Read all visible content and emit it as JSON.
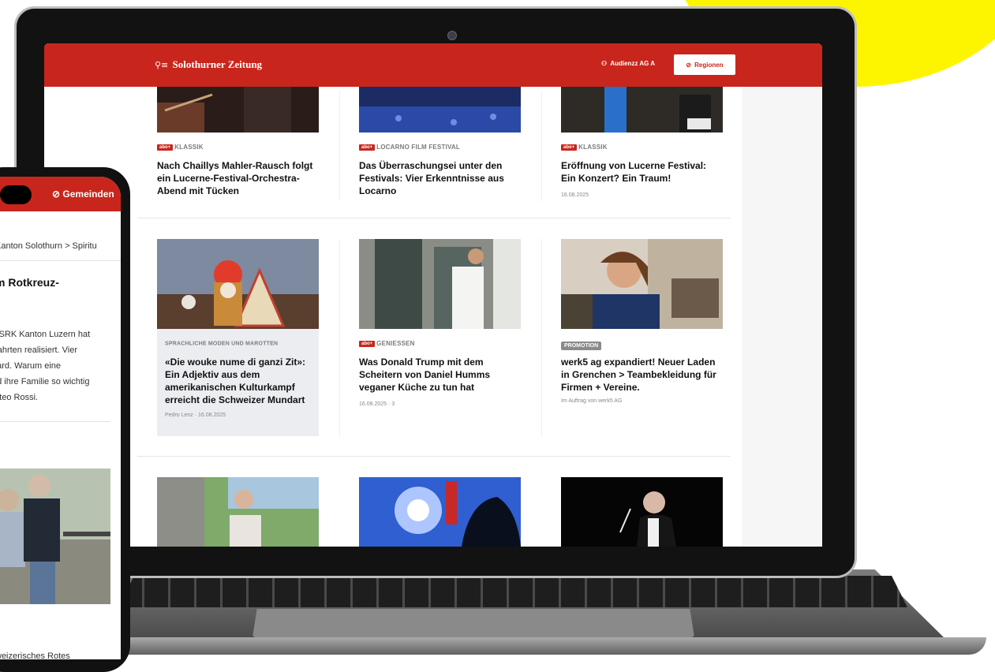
{
  "site": {
    "logo": "Solothurner Zeitung",
    "user": "Audienzz AG A",
    "regions_button": "Regionen",
    "brand_red": "#c8261c"
  },
  "rows": [
    [
      {
        "badge": "abo+",
        "kicker": "KLASSIK",
        "title": "Nach Chaillys Mahler-Rausch folgt ein Lucerne-Festival-Orchestra-Abend mit Tücken",
        "meta": ""
      },
      {
        "badge": "abo+",
        "kicker": "LOCARNO FILM FESTIVAL",
        "title": "Das Überraschungsei unter den Festivals: Vier Erkenntnisse aus Locarno",
        "meta": ""
      },
      {
        "badge": "abo+",
        "kicker": "KLASSIK",
        "title": "Eröffnung von Lucerne Festival: Ein Konzert? Ein Traum!",
        "meta": "16.08.2025"
      }
    ],
    [
      {
        "badge": "",
        "kicker": "SPRACHLICHE MODEN UND MAROTTEN",
        "title": "«Die wouke nume di ganzi Zit»: Ein Adjektiv aus dem amerikanischen Kulturkampf erreicht die Schweizer Mundart",
        "meta": "Pedro Lenz   ·   16.08.2025"
      },
      {
        "badge": "abo+",
        "kicker": "GENIESSEN",
        "title": "Was Donald Trump mit dem Scheitern von Daniel Humms veganer Küche zu tun hat",
        "meta": "16.08.2025   ·   3"
      },
      {
        "badge": "",
        "kicker": "PROMOTION",
        "title": "werk5 ag expandiert! Neuer Laden in Grenchen > Teambekleidung für Firmen + Vereine.",
        "meta": "Im Auftrag von werk5 AG"
      }
    ]
  ],
  "phone": {
    "header_button": "Gemeinden",
    "breadcrumb": "Kanton Solothurn  >  Spiritu",
    "headline": "m Rotkreuz-",
    "text_lines": [
      "s SRK Kanton Luzern hat",
      " Fahrten realisiert. Vier",
      "hard. Warum eine",
      "nd ihre Familie so wichtig",
      "atteo Rossi."
    ],
    "bottom_text": "weizerisches Rotes"
  }
}
